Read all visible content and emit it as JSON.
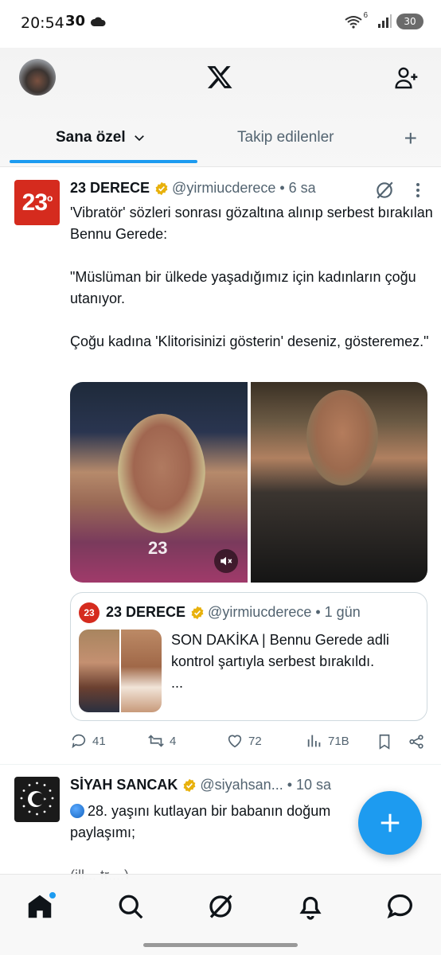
{
  "status": {
    "time": "20:54",
    "left_badge": "30",
    "battery": "30",
    "wifi_badge": "6"
  },
  "header": {
    "tabs": [
      {
        "label": "Sana özel"
      },
      {
        "label": "Takip edilenler"
      }
    ],
    "add_tab_icon": "plus-icon",
    "logo": "x-logo"
  },
  "tweets": [
    {
      "name": "23 DERECE",
      "handle": "@yirmiucderece",
      "sep": "•",
      "time": "6 sa",
      "avatar_text": "23",
      "text": "'Vibratör' sözleri sonrası gözaltına alınıp serbest bırakılan Bennu Gerede:\n\n\"Müslüman bir ülkede yaşadığımız için kadınların çoğu utanıyor.\n\nÇoğu kadına 'Klitorisinizi gösterin' deseniz, gösteremez.\"",
      "media_watermark": "23",
      "quote": {
        "name": "23 DERECE",
        "handle": "@yirmiucderece",
        "sep": "•",
        "time": "1 gün",
        "text": "SON DAKİKA | Bennu Gerede adli kontrol şartıyla serbest bırakıldı.\n..."
      },
      "actions": {
        "replies": "41",
        "reposts": "4",
        "likes": "72",
        "views": "71B"
      }
    },
    {
      "name": "SİYAH SANCAK",
      "handle": "@siyahsan...",
      "sep": "•",
      "time": "10 sa",
      "text_line1": "28. yaşını kutlayan bir babanın doğum",
      "text_line2": "paylaşımı;",
      "text_line3": "(ill... tr....)"
    }
  ],
  "colors": {
    "accent": "#1d9bf0",
    "brand_23": "#d52b1e",
    "verified": "#e8b10c",
    "secondary_text": "#536471"
  },
  "bottom_nav": [
    "home-icon",
    "search-icon",
    "grok-icon",
    "notifications-icon",
    "messages-icon"
  ]
}
